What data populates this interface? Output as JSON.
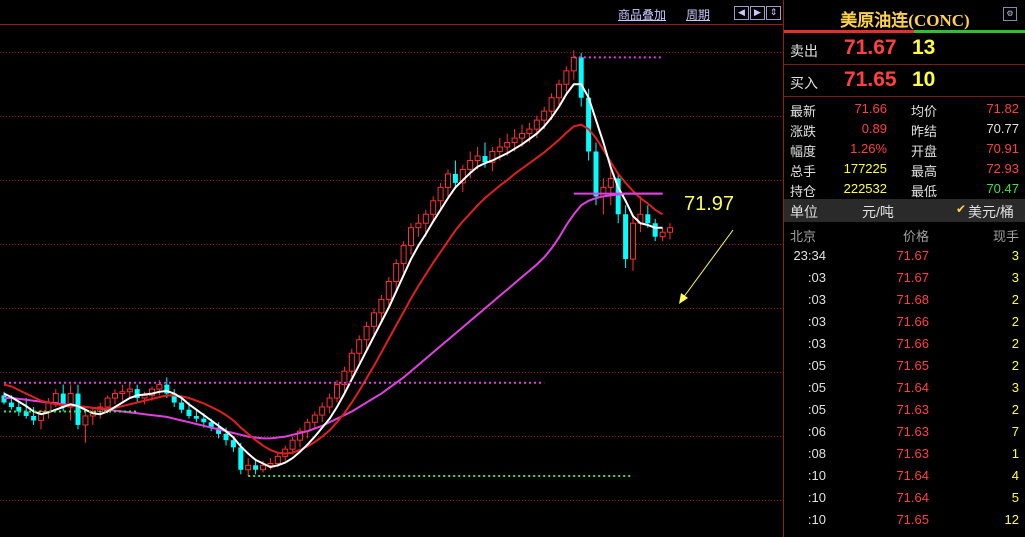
{
  "toolbar": {
    "overlay_label": "商品叠加",
    "period_label": "周期"
  },
  "price_callout": "71.97",
  "colors": {
    "up_candle": "#ff3030",
    "down_candle": "#00ffff",
    "ma_short": "#ffffff",
    "ma_mid": "#e02020",
    "ma_long": "#e040e0",
    "grid": "#8a1a1a",
    "level_line": "#e040e0",
    "low_line": "#40e040"
  },
  "chart_data": {
    "type": "candlestick",
    "title": "",
    "xlabel": "",
    "ylabel": "",
    "ylim": [
      67.5,
      73.2
    ],
    "grid": true,
    "candles": [
      {
        "o": 69.08,
        "h": 69.12,
        "l": 68.98,
        "c": 69.0
      },
      {
        "o": 69.0,
        "h": 69.08,
        "l": 68.92,
        "c": 68.95
      },
      {
        "o": 68.95,
        "h": 69.02,
        "l": 68.85,
        "c": 68.9
      },
      {
        "o": 68.9,
        "h": 69.05,
        "l": 68.82,
        "c": 68.85
      },
      {
        "o": 68.85,
        "h": 68.95,
        "l": 68.75,
        "c": 68.8
      },
      {
        "o": 68.8,
        "h": 68.92,
        "l": 68.7,
        "c": 68.9
      },
      {
        "o": 68.9,
        "h": 69.05,
        "l": 68.82,
        "c": 69.0
      },
      {
        "o": 69.0,
        "h": 69.15,
        "l": 68.95,
        "c": 69.1
      },
      {
        "o": 69.1,
        "h": 69.2,
        "l": 68.9,
        "c": 68.95
      },
      {
        "o": 68.95,
        "h": 69.2,
        "l": 68.8,
        "c": 69.1
      },
      {
        "o": 69.1,
        "h": 69.2,
        "l": 68.7,
        "c": 68.75
      },
      {
        "o": 68.75,
        "h": 68.9,
        "l": 68.55,
        "c": 68.85
      },
      {
        "o": 68.85,
        "h": 68.95,
        "l": 68.75,
        "c": 68.9
      },
      {
        "o": 68.9,
        "h": 69.0,
        "l": 68.82,
        "c": 68.95
      },
      {
        "o": 68.95,
        "h": 69.08,
        "l": 68.88,
        "c": 69.05
      },
      {
        "o": 69.05,
        "h": 69.15,
        "l": 68.98,
        "c": 69.1
      },
      {
        "o": 69.1,
        "h": 69.2,
        "l": 69.02,
        "c": 69.12
      },
      {
        "o": 69.12,
        "h": 69.22,
        "l": 69.05,
        "c": 69.15
      },
      {
        "o": 69.15,
        "h": 69.2,
        "l": 69.0,
        "c": 69.05
      },
      {
        "o": 69.05,
        "h": 69.12,
        "l": 68.98,
        "c": 69.08
      },
      {
        "o": 69.08,
        "h": 69.18,
        "l": 69.02,
        "c": 69.15
      },
      {
        "o": 69.15,
        "h": 69.25,
        "l": 69.08,
        "c": 69.2
      },
      {
        "o": 69.2,
        "h": 69.28,
        "l": 69.05,
        "c": 69.1
      },
      {
        "o": 69.1,
        "h": 69.15,
        "l": 68.95,
        "c": 69.0
      },
      {
        "o": 69.0,
        "h": 69.08,
        "l": 68.88,
        "c": 68.92
      },
      {
        "o": 68.92,
        "h": 69.0,
        "l": 68.82,
        "c": 68.85
      },
      {
        "o": 68.85,
        "h": 68.92,
        "l": 68.78,
        "c": 68.82
      },
      {
        "o": 68.82,
        "h": 68.88,
        "l": 68.72,
        "c": 68.78
      },
      {
        "o": 68.78,
        "h": 68.82,
        "l": 68.68,
        "c": 68.72
      },
      {
        "o": 68.72,
        "h": 68.78,
        "l": 68.6,
        "c": 68.65
      },
      {
        "o": 68.65,
        "h": 68.72,
        "l": 68.52,
        "c": 68.58
      },
      {
        "o": 68.58,
        "h": 68.62,
        "l": 68.45,
        "c": 68.5
      },
      {
        "o": 68.5,
        "h": 68.55,
        "l": 68.2,
        "c": 68.25
      },
      {
        "o": 68.25,
        "h": 68.38,
        "l": 68.18,
        "c": 68.3
      },
      {
        "o": 68.3,
        "h": 68.35,
        "l": 68.2,
        "c": 68.25
      },
      {
        "o": 68.25,
        "h": 68.35,
        "l": 68.22,
        "c": 68.3
      },
      {
        "o": 68.3,
        "h": 68.38,
        "l": 68.25,
        "c": 68.32
      },
      {
        "o": 68.32,
        "h": 68.45,
        "l": 68.28,
        "c": 68.4
      },
      {
        "o": 68.4,
        "h": 68.52,
        "l": 68.35,
        "c": 68.48
      },
      {
        "o": 68.48,
        "h": 68.62,
        "l": 68.42,
        "c": 68.58
      },
      {
        "o": 68.58,
        "h": 68.72,
        "l": 68.5,
        "c": 68.68
      },
      {
        "o": 68.68,
        "h": 68.82,
        "l": 68.6,
        "c": 68.78
      },
      {
        "o": 68.78,
        "h": 68.9,
        "l": 68.7,
        "c": 68.86
      },
      {
        "o": 68.86,
        "h": 69.0,
        "l": 68.78,
        "c": 68.95
      },
      {
        "o": 68.95,
        "h": 69.1,
        "l": 68.88,
        "c": 69.05
      },
      {
        "o": 69.05,
        "h": 69.25,
        "l": 69.0,
        "c": 69.2
      },
      {
        "o": 69.2,
        "h": 69.4,
        "l": 69.12,
        "c": 69.35
      },
      {
        "o": 69.35,
        "h": 69.6,
        "l": 69.28,
        "c": 69.55
      },
      {
        "o": 69.55,
        "h": 69.75,
        "l": 69.45,
        "c": 69.7
      },
      {
        "o": 69.7,
        "h": 69.9,
        "l": 69.6,
        "c": 69.85
      },
      {
        "o": 69.85,
        "h": 70.05,
        "l": 69.75,
        "c": 70.0
      },
      {
        "o": 70.0,
        "h": 70.2,
        "l": 69.9,
        "c": 70.15
      },
      {
        "o": 70.15,
        "h": 70.4,
        "l": 70.05,
        "c": 70.35
      },
      {
        "o": 70.35,
        "h": 70.6,
        "l": 70.25,
        "c": 70.55
      },
      {
        "o": 70.55,
        "h": 70.8,
        "l": 70.45,
        "c": 70.75
      },
      {
        "o": 70.75,
        "h": 71.0,
        "l": 70.65,
        "c": 70.95
      },
      {
        "o": 70.95,
        "h": 71.1,
        "l": 70.85,
        "c": 71.0
      },
      {
        "o": 71.0,
        "h": 71.15,
        "l": 70.85,
        "c": 71.1
      },
      {
        "o": 71.1,
        "h": 71.3,
        "l": 71.0,
        "c": 71.25
      },
      {
        "o": 71.25,
        "h": 71.45,
        "l": 71.15,
        "c": 71.4
      },
      {
        "o": 71.4,
        "h": 71.6,
        "l": 71.3,
        "c": 71.55
      },
      {
        "o": 71.55,
        "h": 71.7,
        "l": 71.4,
        "c": 71.45
      },
      {
        "o": 71.45,
        "h": 71.65,
        "l": 71.35,
        "c": 71.6
      },
      {
        "o": 71.6,
        "h": 71.8,
        "l": 71.5,
        "c": 71.7
      },
      {
        "o": 71.7,
        "h": 71.85,
        "l": 71.6,
        "c": 71.75
      },
      {
        "o": 71.75,
        "h": 71.9,
        "l": 71.62,
        "c": 71.68
      },
      {
        "o": 71.68,
        "h": 71.85,
        "l": 71.58,
        "c": 71.8
      },
      {
        "o": 71.8,
        "h": 71.95,
        "l": 71.7,
        "c": 71.85
      },
      {
        "o": 71.85,
        "h": 72.0,
        "l": 71.75,
        "c": 71.9
      },
      {
        "o": 71.9,
        "h": 72.05,
        "l": 71.8,
        "c": 71.95
      },
      {
        "o": 71.95,
        "h": 72.1,
        "l": 71.85,
        "c": 72.0
      },
      {
        "o": 72.0,
        "h": 72.12,
        "l": 71.9,
        "c": 72.05
      },
      {
        "o": 72.05,
        "h": 72.2,
        "l": 71.95,
        "c": 72.15
      },
      {
        "o": 72.15,
        "h": 72.3,
        "l": 72.05,
        "c": 72.25
      },
      {
        "o": 72.25,
        "h": 72.45,
        "l": 72.15,
        "c": 72.4
      },
      {
        "o": 72.4,
        "h": 72.6,
        "l": 72.3,
        "c": 72.55
      },
      {
        "o": 72.55,
        "h": 72.75,
        "l": 72.45,
        "c": 72.7
      },
      {
        "o": 72.7,
        "h": 72.93,
        "l": 72.6,
        "c": 72.85
      },
      {
        "o": 72.85,
        "h": 72.9,
        "l": 72.3,
        "c": 72.4
      },
      {
        "o": 72.4,
        "h": 72.5,
        "l": 71.7,
        "c": 71.8
      },
      {
        "o": 71.8,
        "h": 71.9,
        "l": 71.2,
        "c": 71.3
      },
      {
        "o": 71.3,
        "h": 71.5,
        "l": 71.1,
        "c": 71.4
      },
      {
        "o": 71.4,
        "h": 71.6,
        "l": 71.2,
        "c": 71.5
      },
      {
        "o": 71.5,
        "h": 71.55,
        "l": 71.0,
        "c": 71.1
      },
      {
        "o": 71.1,
        "h": 71.2,
        "l": 70.5,
        "c": 70.6
      },
      {
        "o": 70.6,
        "h": 71.1,
        "l": 70.47,
        "c": 71.0
      },
      {
        "o": 71.0,
        "h": 71.3,
        "l": 70.9,
        "c": 71.1
      },
      {
        "o": 71.1,
        "h": 71.2,
        "l": 70.95,
        "c": 71.0
      },
      {
        "o": 71.0,
        "h": 71.05,
        "l": 70.8,
        "c": 70.85
      },
      {
        "o": 70.85,
        "h": 70.95,
        "l": 70.8,
        "c": 70.9
      },
      {
        "o": 70.9,
        "h": 71.0,
        "l": 70.82,
        "c": 70.95
      }
    ],
    "ma_short": [
      69.1,
      69.06,
      69.01,
      68.96,
      68.9,
      68.87,
      68.89,
      68.92,
      68.95,
      68.98,
      68.96,
      68.92,
      68.88,
      68.87,
      68.9,
      68.95,
      69.0,
      69.05,
      69.08,
      69.09,
      69.1,
      69.12,
      69.13,
      69.1,
      69.05,
      68.98,
      68.92,
      68.86,
      68.8,
      68.74,
      68.68,
      68.61,
      68.51,
      68.43,
      68.36,
      68.32,
      68.28,
      68.3,
      68.33,
      68.38,
      68.45,
      68.53,
      68.62,
      68.72,
      68.82,
      68.95,
      69.1,
      69.26,
      69.42,
      69.58,
      69.74,
      69.9,
      70.06,
      70.24,
      70.42,
      70.6,
      70.75,
      70.88,
      71.02,
      71.15,
      71.28,
      71.4,
      71.48,
      71.56,
      71.63,
      71.67,
      71.7,
      71.74,
      71.78,
      71.83,
      71.88,
      71.94,
      72.0,
      72.08,
      72.18,
      72.3,
      72.44,
      72.55,
      72.55,
      72.4,
      72.15,
      71.9,
      71.62,
      71.4,
      71.25,
      71.08,
      71.0,
      70.98,
      70.95,
      70.95
    ],
    "ma_mid": [
      69.2,
      69.18,
      69.14,
      69.1,
      69.06,
      69.02,
      69.0,
      68.98,
      68.97,
      68.97,
      68.96,
      68.95,
      68.94,
      68.93,
      68.93,
      68.94,
      68.96,
      68.98,
      69.0,
      69.02,
      69.04,
      69.06,
      69.08,
      69.08,
      69.07,
      69.05,
      69.02,
      68.99,
      68.95,
      68.91,
      68.86,
      68.8,
      68.72,
      68.65,
      68.58,
      68.52,
      68.47,
      68.44,
      68.43,
      68.44,
      68.47,
      68.51,
      68.56,
      68.62,
      68.69,
      68.78,
      68.88,
      69.0,
      69.13,
      69.27,
      69.41,
      69.56,
      69.71,
      69.86,
      70.01,
      70.16,
      70.3,
      70.43,
      70.56,
      70.68,
      70.8,
      70.92,
      71.02,
      71.11,
      71.2,
      71.28,
      71.35,
      71.42,
      71.48,
      71.55,
      71.61,
      71.67,
      71.73,
      71.79,
      71.86,
      71.93,
      72.01,
      72.08,
      72.1,
      72.05,
      71.95,
      71.82,
      71.68,
      71.55,
      71.45,
      71.36,
      71.28,
      71.22,
      71.15,
      71.1
    ],
    "ma_long": [
      69.05,
      69.05,
      69.04,
      69.03,
      69.02,
      69.01,
      69.0,
      68.99,
      68.98,
      68.97,
      68.96,
      68.95,
      68.94,
      68.93,
      68.92,
      68.91,
      68.9,
      68.89,
      68.88,
      68.87,
      68.86,
      68.85,
      68.84,
      68.82,
      68.8,
      68.78,
      68.76,
      68.74,
      68.72,
      68.7,
      68.68,
      68.66,
      68.64,
      68.62,
      68.61,
      68.6,
      68.6,
      68.61,
      68.62,
      68.64,
      68.66,
      68.68,
      68.71,
      68.74,
      68.78,
      68.82,
      68.86,
      68.9,
      68.95,
      69.0,
      69.05,
      69.1,
      69.16,
      69.22,
      69.28,
      69.35,
      69.42,
      69.49,
      69.56,
      69.63,
      69.7,
      69.77,
      69.84,
      69.91,
      69.98,
      70.05,
      70.12,
      70.19,
      70.26,
      70.33,
      70.4,
      70.47,
      70.54,
      70.62,
      70.72,
      70.84,
      70.98,
      71.1,
      71.2,
      71.25,
      71.28,
      71.3,
      71.31,
      71.32,
      71.33,
      71.33,
      71.33,
      71.33,
      71.33,
      71.33
    ],
    "level_lines": [
      {
        "value": 72.85,
        "style": "dotted",
        "color": "#e040e0",
        "from": 77,
        "to": 89
      },
      {
        "value": 71.33,
        "style": "solid",
        "color": "#e040e0",
        "from": 77,
        "to": 89
      },
      {
        "value": 69.22,
        "style": "dotted",
        "color": "#e040e0",
        "from": 0,
        "to": 73
      },
      {
        "value": 68.9,
        "style": "dotted",
        "color": "#40e040",
        "from": 0,
        "to": 18
      },
      {
        "value": 68.18,
        "style": "dotted",
        "color": "#40e040",
        "from": 33,
        "to": 85
      }
    ]
  },
  "quote": {
    "title": "美原油连(CONC)",
    "sell_label": "卖出",
    "sell_price": "71.67",
    "sell_vol": "13",
    "buy_label": "买入",
    "buy_price": "71.65",
    "buy_vol": "10",
    "stats": [
      {
        "l1": "最新",
        "v1": "71.66",
        "c1": "#ff4040",
        "l2": "均价",
        "v2": "71.82",
        "c2": "#ff4040"
      },
      {
        "l1": "涨跌",
        "v1": "0.89",
        "c1": "#ff4040",
        "l2": "昨结",
        "v2": "70.77",
        "c2": "#e0e0e0"
      },
      {
        "l1": "幅度",
        "v1": "1.26%",
        "c1": "#ff4040",
        "l2": "开盘",
        "v2": "70.91",
        "c2": "#ff4040"
      },
      {
        "l1": "总手",
        "v1": "177225",
        "c1": "#ffff40",
        "l2": "最高",
        "v2": "72.93",
        "c2": "#ff4040"
      },
      {
        "l1": "持仓",
        "v1": "222532",
        "c1": "#ffff40",
        "l2": "最低",
        "v2": "70.47",
        "c2": "#40e040"
      }
    ],
    "unit_label": "单位",
    "unit_value1": "元/吨",
    "unit_check": "✔",
    "unit_value2": "美元/桶",
    "tick_headers": {
      "time": "北京",
      "price": "价格",
      "vol": "现手"
    },
    "ticks": [
      {
        "time": "23:34",
        "price": "71.67",
        "vol": "3"
      },
      {
        "time": ":03",
        "price": "71.67",
        "vol": "3"
      },
      {
        "time": ":03",
        "price": "71.68",
        "vol": "2"
      },
      {
        "time": ":03",
        "price": "71.66",
        "vol": "2"
      },
      {
        "time": ":03",
        "price": "71.66",
        "vol": "2"
      },
      {
        "time": ":05",
        "price": "71.65",
        "vol": "2"
      },
      {
        "time": ":05",
        "price": "71.64",
        "vol": "3"
      },
      {
        "time": ":05",
        "price": "71.63",
        "vol": "2"
      },
      {
        "time": ":06",
        "price": "71.63",
        "vol": "7"
      },
      {
        "time": ":08",
        "price": "71.63",
        "vol": "1"
      },
      {
        "time": ":10",
        "price": "71.64",
        "vol": "4"
      },
      {
        "time": ":10",
        "price": "71.64",
        "vol": "5"
      },
      {
        "time": ":10",
        "price": "71.65",
        "vol": "12"
      }
    ]
  }
}
